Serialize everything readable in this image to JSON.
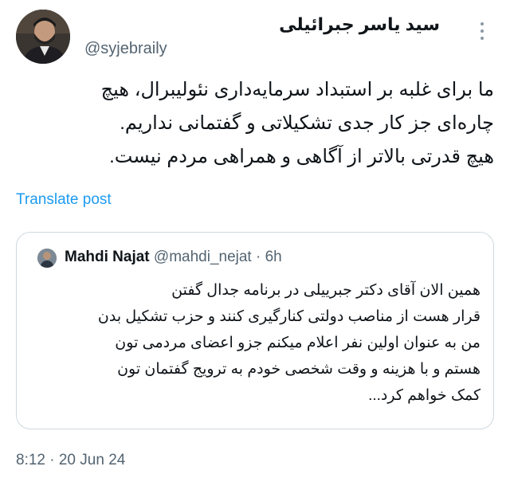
{
  "author": {
    "display_name": "سید یاسر جبرائیلی",
    "handle": "@syjebraily"
  },
  "menu": {
    "more_icon": "more-vertical-icon"
  },
  "tweet": {
    "lines": [
      "ما برای غلبه بر استبداد سرمایه‌داری نئولیبرال، هیچ",
      "چاره‌ای جز کار جدی تشکیلاتی و گفتمانی نداریم.",
      "هیچ قدرتی بالاتر از آگاهی و همراهی مردم نیست."
    ],
    "translate_label": "Translate post",
    "timestamp": "8:12 · 20 Jun 24"
  },
  "quote": {
    "display_name": "Mahdi Najat",
    "meta": "@mahdi_nejat · 6h",
    "lines": [
      "همین الان آقای دکتر جبرییلی در برنامه جدال گفتن",
      "قرار هست از مناصب دولتی کنارگیری کنند و حزب تشکیل بدن",
      "من به عنوان اولین نفر اعلام میکنم جزو اعضای مردمی تون",
      "هستم و با هزینه و وقت شخصی خودم به ترویج گفتمان تون",
      "کمک خواهم کرد..."
    ]
  },
  "colors": {
    "accent": "#1d9bf0",
    "secondary_text": "#536471",
    "border": "#cfd9de"
  }
}
